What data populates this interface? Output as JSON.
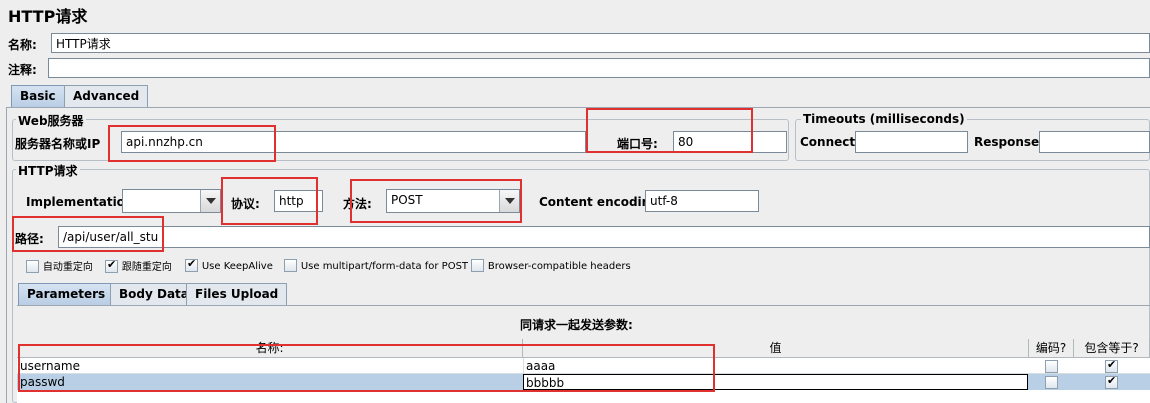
{
  "title": "HTTP请求",
  "name_label": "名称:",
  "name_value": "HTTP请求",
  "comment_label": "注释:",
  "tabs": [
    "Basic",
    "Advanced"
  ],
  "web_server": {
    "group_title": "Web服务器",
    "host_label": "服务器名称或IP",
    "host_value": "api.nnzhp.cn",
    "port_label": "端口号:",
    "port_value": "80"
  },
  "timeouts": {
    "group_title": "Timeouts (milliseconds)",
    "connect_label": "Connect:",
    "connect_value": "",
    "response_label": "Response:",
    "response_value": ""
  },
  "http_request": {
    "group_title": "HTTP请求",
    "implementation_label": "Implementation:",
    "implementation_value": "",
    "protocol_label": "协议:",
    "protocol_value": "http",
    "method_label": "方法:",
    "method_value": "POST",
    "encoding_label": "Content encoding:",
    "encoding_value": "utf-8",
    "path_label": "路径:",
    "path_value": "/api/user/all_stu"
  },
  "options": [
    {
      "label": "自动重定向",
      "checked": false
    },
    {
      "label": "跟随重定向",
      "checked": true
    },
    {
      "label": "Use KeepAlive",
      "checked": true
    },
    {
      "label": "Use multipart/form-data for POST",
      "checked": false
    },
    {
      "label": "Browser-compatible headers",
      "checked": false
    }
  ],
  "sub_tabs": [
    "Parameters",
    "Body Data",
    "Files Upload"
  ],
  "params": {
    "caption": "同请求一起发送参数:",
    "columns": [
      "名称:",
      "值",
      "编码?",
      "包含等于?"
    ],
    "rows": [
      {
        "name": "username",
        "value": "aaaa",
        "encode": false,
        "include_equals": true
      },
      {
        "name": "passwd",
        "value": "bbbbb",
        "encode": false,
        "include_equals": true
      }
    ]
  },
  "colors": {
    "highlight": "#e03030",
    "selected_row": "#b8cfe5",
    "tab_active": "#c6d7ea"
  }
}
